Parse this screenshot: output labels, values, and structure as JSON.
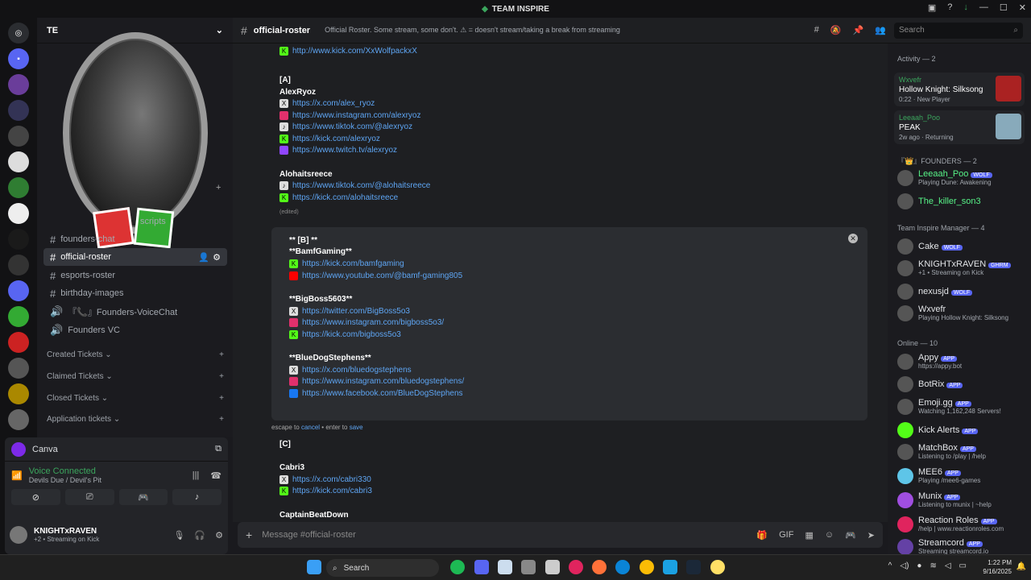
{
  "window": {
    "title": "TEAM INSPIRE"
  },
  "server": {
    "name": "TEAM INSPIRE",
    "short": "TE"
  },
  "channels": [
    {
      "label": "scripts"
    },
    {
      "label": "founders-chat"
    },
    {
      "label": "official-roster"
    },
    {
      "label": "esports-roster"
    },
    {
      "label": "birthday-images"
    },
    {
      "label": "『📞』Founders-VoiceChat"
    },
    {
      "label": "Founders VC"
    }
  ],
  "categories": [
    {
      "label": "Created Tickets"
    },
    {
      "label": "Claimed Tickets"
    },
    {
      "label": "Closed Tickets"
    },
    {
      "label": "Application tickets"
    }
  ],
  "activity_panel": {
    "label": "Canva"
  },
  "voice": {
    "title": "Voice Connected",
    "sub": "Devils Due / Devil's Pit"
  },
  "user": {
    "name": "KNIGHTxRAVEN",
    "status": "+2 • Streaming on Kick"
  },
  "channel": {
    "name": "official-roster",
    "topic": "Official Roster. Some stream, some don't. ⚠ = doesn't stream/taking a break from streaming"
  },
  "search": {
    "placeholder": "Search"
  },
  "messages": {
    "top_link": "http://www.kick.com/XxWolfpackxX",
    "sec_a": "[A]",
    "alex_name": "AlexRyoz",
    "alex_links": [
      "https://x.com/alex_ryoz",
      "https://www.instagram.com/alexryoz",
      "https://www.tiktok.com/@alexryoz",
      "https://kick.com/alexryoz",
      "https://www.twitch.tv/alexryoz"
    ],
    "aloha_name": "Alohaitsreece",
    "aloha_links": [
      "https://www.tiktok.com/@alohaitsreece",
      "https://kick.com/alohaitsreece"
    ],
    "edited": "(edited)",
    "edit_sec": "** [B] **",
    "bamf_name": "**BamfGaming**",
    "bamf_links": [
      "https://kick.com/bamfgaming",
      "https://www.youtube.com/@bamf-gaming805"
    ],
    "bigboss_name": "**BigBoss5603**",
    "bigboss_links": [
      "https://twitter.com/BigBoss5o3",
      "https://www.instagram.com/bigboss5o3/",
      "https://kick.com/bigboss5o3"
    ],
    "bluedog_name": "**BlueDogStephens**",
    "bluedog_links": [
      "https://x.com/bluedogstephens",
      "https://www.instagram.com/bluedogstephens/",
      "https://www.facebook.com/BlueDogStephens"
    ],
    "hint_pre": "escape to",
    "hint_cancel": "cancel",
    "hint_mid": "• enter to",
    "hint_save": "save",
    "sec_c": "[C]",
    "cabri_name": "Cabri3",
    "cabri_links": [
      "https://x.com/cabri330",
      "https://kick.com/cabri3"
    ],
    "captain_name": "CaptainBeatDown"
  },
  "composer": {
    "placeholder": "Message #official-roster"
  },
  "members": {
    "activity_header": "Activity — 2",
    "activity": [
      {
        "user": "Wxvefr",
        "game": "Hollow Knight: Silksong",
        "meta": "0:22 · New Player"
      },
      {
        "user": "Leeaah_Poo",
        "game": "PEAK",
        "meta": "2w ago · Returning"
      }
    ],
    "founders_header": "『👑』FOUNDERS — 2",
    "founders": [
      {
        "name": "Leeaah_Poo",
        "tag": "WOLF",
        "status": "Playing Dune: Awakening"
      },
      {
        "name": "The_killer_son3",
        "tag": "",
        "status": ""
      }
    ],
    "managers_header": "Team Inspire Manager — 4",
    "managers": [
      {
        "name": "Cake",
        "tag": "WOLF",
        "status": ""
      },
      {
        "name": "KNIGHTxRAVEN",
        "tag": "GHRM",
        "status": "+1 • Streaming on Kick"
      },
      {
        "name": "nexusjd",
        "tag": "WOLF",
        "status": ""
      },
      {
        "name": "Wxvefr",
        "tag": "",
        "status": "Playing Hollow Knight: Silksong"
      }
    ],
    "online_header": "Online — 10",
    "online": [
      {
        "name": "Appy",
        "status": "https://appy.bot"
      },
      {
        "name": "BotRix",
        "status": ""
      },
      {
        "name": "Emoji.gg",
        "status": "Watching 1,162,248 Servers!"
      },
      {
        "name": "Kick Alerts",
        "status": ""
      },
      {
        "name": "MatchBox",
        "status": "Listening to /play | /help"
      },
      {
        "name": "MEE6",
        "status": "Playing /mee6-games"
      },
      {
        "name": "Munix",
        "status": "Listening to munix | ~help"
      },
      {
        "name": "Reaction Roles",
        "status": "/help | www.reactionroles.com"
      },
      {
        "name": "Streamcord",
        "status": "Streaming streamcord.io"
      }
    ],
    "app_tag": "APP"
  },
  "taskbar": {
    "search": "Search",
    "time": "1:22 PM",
    "date": "9/16/2025"
  },
  "colors": {
    "accent": "#5865f2",
    "link": "#5ea5f3",
    "online": "#3ba55d"
  }
}
